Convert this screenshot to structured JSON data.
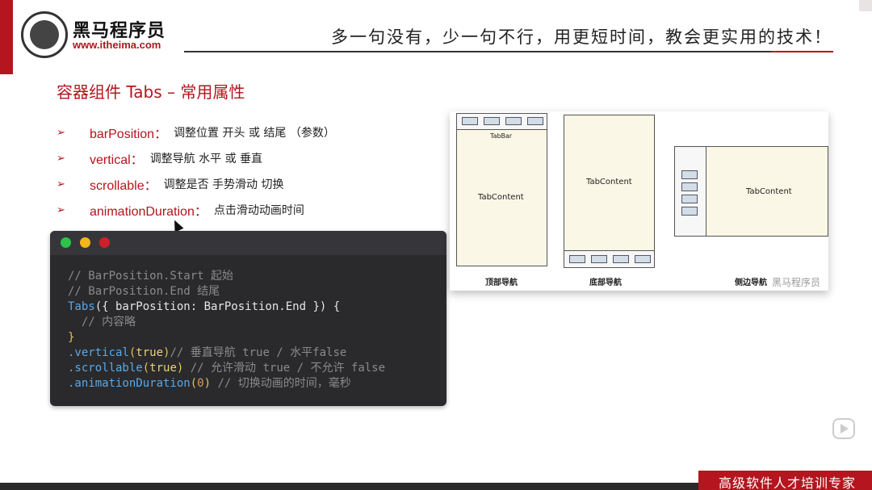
{
  "header": {
    "brand_cn": "黑马程序员",
    "brand_url": "www.itheima.com",
    "slogan": "多一句没有，少一句不行，用更短时间，教会更实用的技术！"
  },
  "slide": {
    "title": "容器组件 Tabs – 常用属性",
    "bullets": [
      {
        "name": "barPosition：",
        "desc": "调整位置 开头 或 结尾 （参数）"
      },
      {
        "name": "vertical：",
        "desc": "调整导航 水平 或 垂直"
      },
      {
        "name": "scrollable：",
        "desc": "调整是否 手势滑动 切换"
      },
      {
        "name": "animationDuration：",
        "desc": "点击滑动动画时间"
      }
    ],
    "bullet_symbol": "➢"
  },
  "code": {
    "l1": "// BarPosition.Start 起始",
    "l2": "// BarPosition.End 结尾",
    "l3a": "Tabs",
    "l3b": "({ barPosition: BarPosition.End }) {",
    "l4": "  // 内容略",
    "l5": "}",
    "l6a": ".vertical",
    "l6b": "(",
    "l6c": "true",
    "l6d": ")",
    "l6e": "// 垂直导航 true / 水平false",
    "l7a": ".scrollable",
    "l7b": "(",
    "l7c": "true",
    "l7d": ")",
    "l7e": " // 允许滑动 true / 不允许 false",
    "l8a": ".animationDuration",
    "l8b": "(",
    "l8c": "0",
    "l8d": ")",
    "l8e": " // 切换动画的时间，毫秒"
  },
  "diagram": {
    "tabbar_label": "TabBar",
    "content_label": "TabContent",
    "cap_top": "顶部导航",
    "cap_bottom": "底部导航",
    "cap_side": "侧边导航",
    "watermark": "黑马程序员"
  },
  "footer": {
    "text": "高级软件人才培训专家"
  },
  "colors": {
    "brand_red": "#b4151e",
    "code_bg": "#2a2a2c",
    "content_fill": "#fbf7e6",
    "tab_fill": "#d3dde8"
  }
}
